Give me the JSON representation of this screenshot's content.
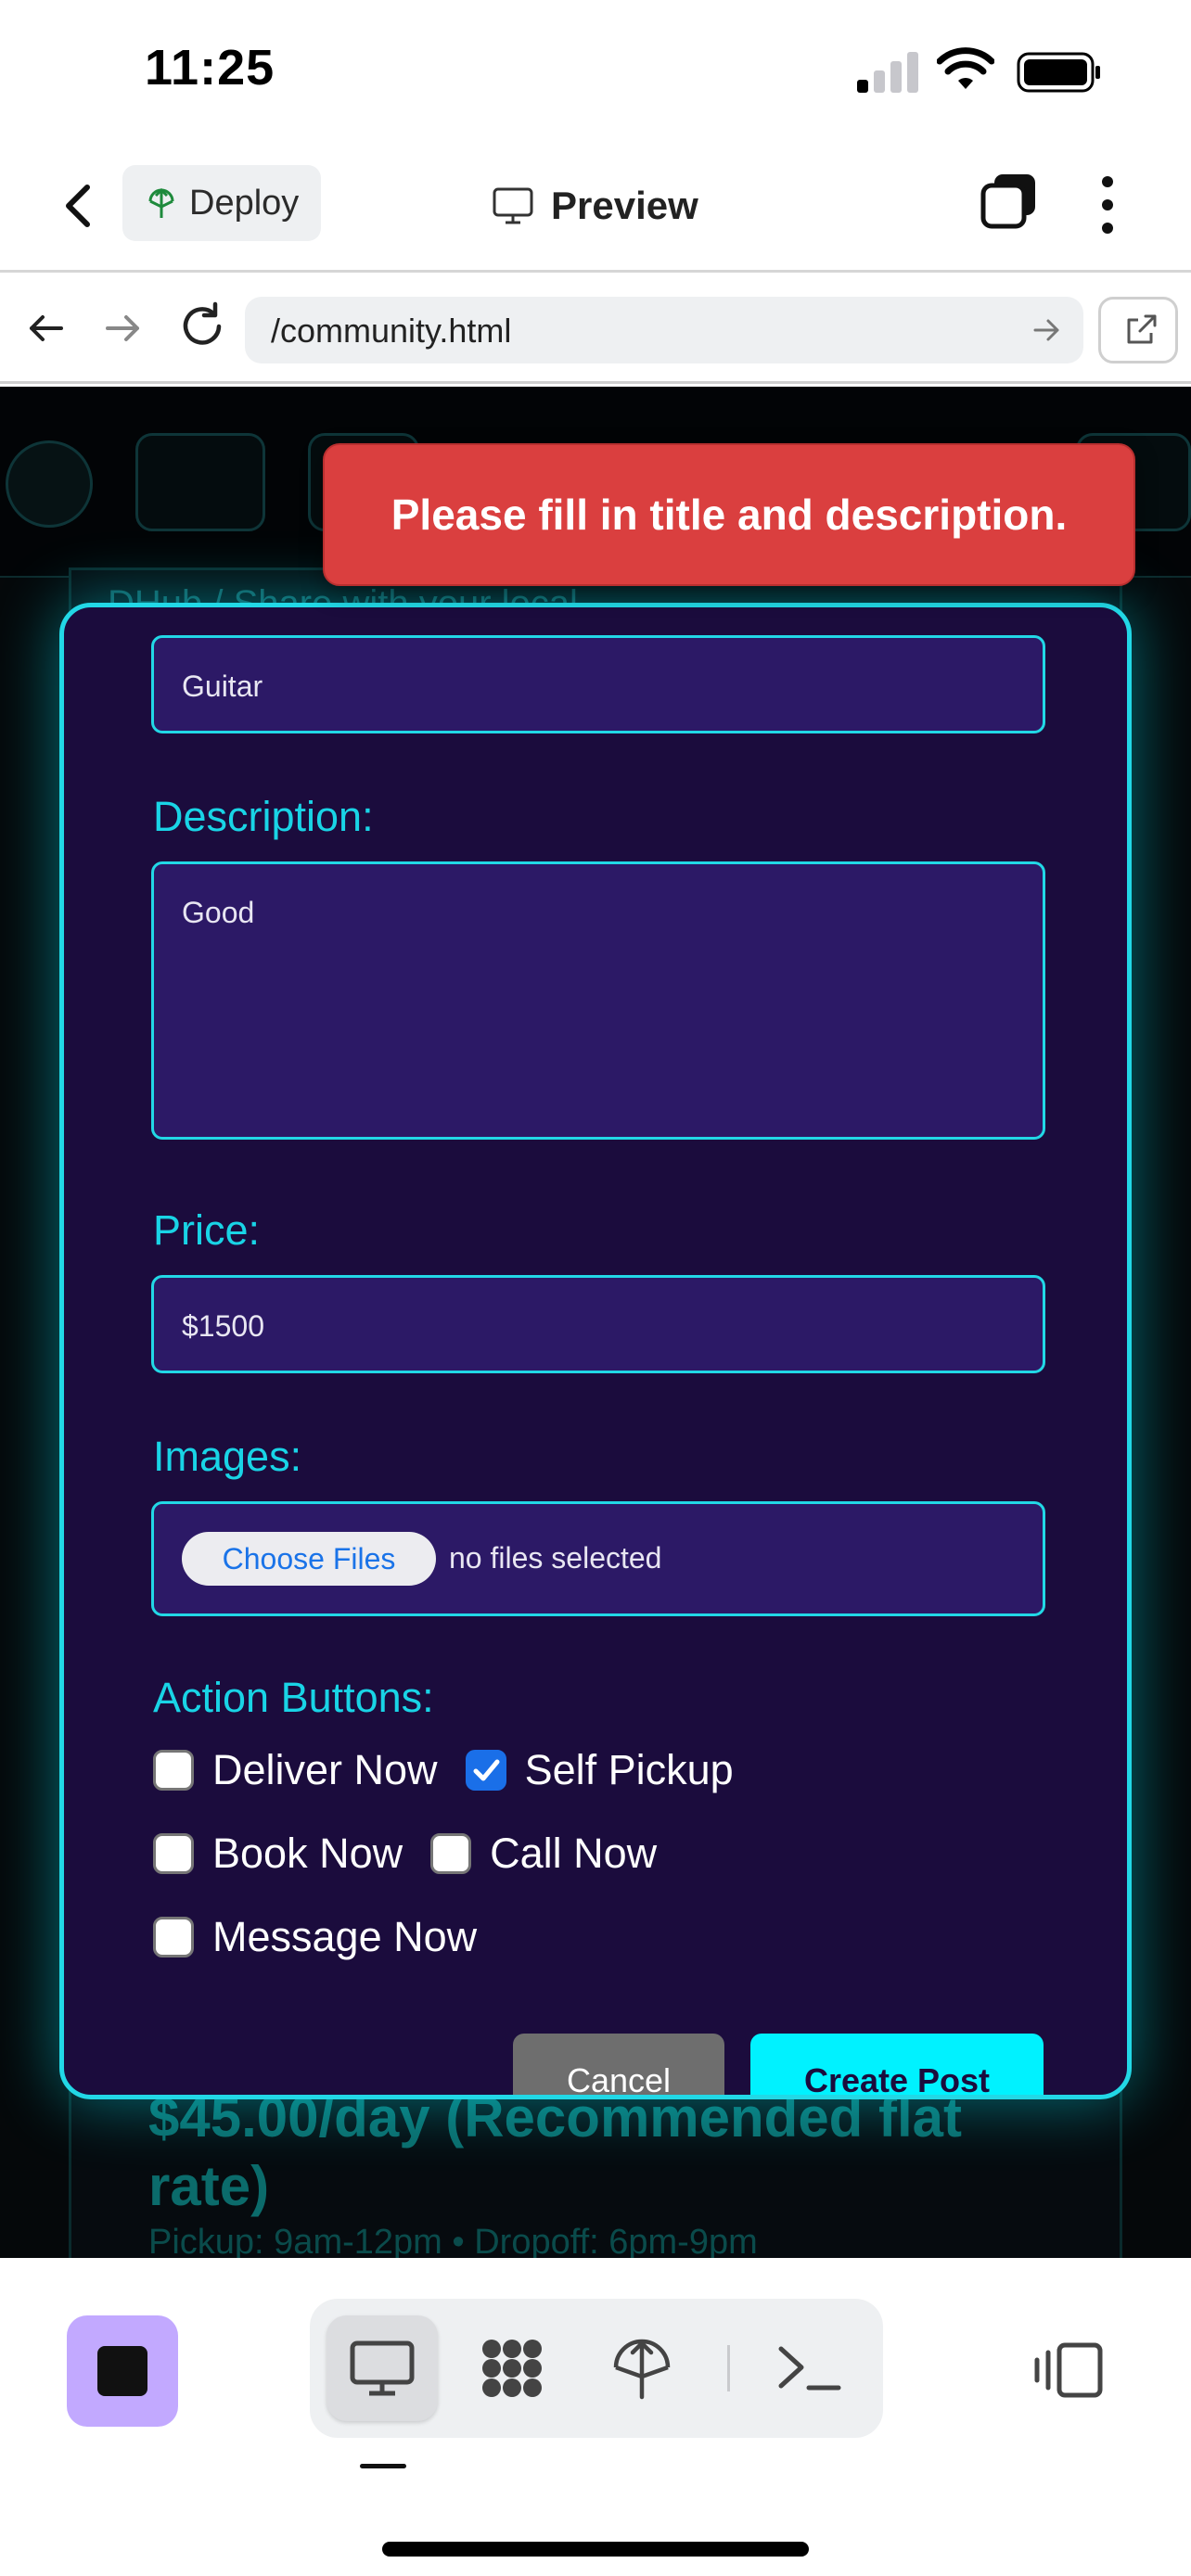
{
  "status_bar": {
    "time": "11:25"
  },
  "app_bar": {
    "deploy_label": "Deploy",
    "title": "Preview"
  },
  "browser": {
    "url": "/community.html"
  },
  "background_page": {
    "price_text": "$45.00/day (Recommended flat rate)",
    "meta_text": "Pickup: 9am-12pm • Dropoff: 6pm-9pm",
    "breadcrumb": "DHub / Share with your local"
  },
  "toast": {
    "message": "Please fill in title and description."
  },
  "form": {
    "title_value": "Guitar",
    "description_label": "Description:",
    "description_value": "Good",
    "price_label": "Price:",
    "price_value": "$1500",
    "images_label": "Images:",
    "choose_files_label": "Choose Files",
    "no_files_text": "no files selected",
    "action_buttons_label": "Action Buttons:",
    "actions": [
      {
        "label": "Deliver Now",
        "checked": false
      },
      {
        "label": "Self Pickup",
        "checked": true
      },
      {
        "label": "Book Now",
        "checked": false
      },
      {
        "label": "Call Now",
        "checked": false
      },
      {
        "label": "Message Now",
        "checked": false
      }
    ],
    "cancel_label": "Cancel",
    "create_label": "Create Post"
  },
  "toolbar": {
    "icons": [
      "stop-icon",
      "desktop-icon",
      "grid-icon",
      "deploy-icon",
      "terminal-icon",
      "panel-icon"
    ]
  },
  "colors": {
    "accent_cyan": "#22d8e6",
    "modal_bg": "#1b0c3d",
    "field_bg": "#2c1966",
    "toast_red": "#da3f3f",
    "stop_purple": "#c2a9ff"
  }
}
